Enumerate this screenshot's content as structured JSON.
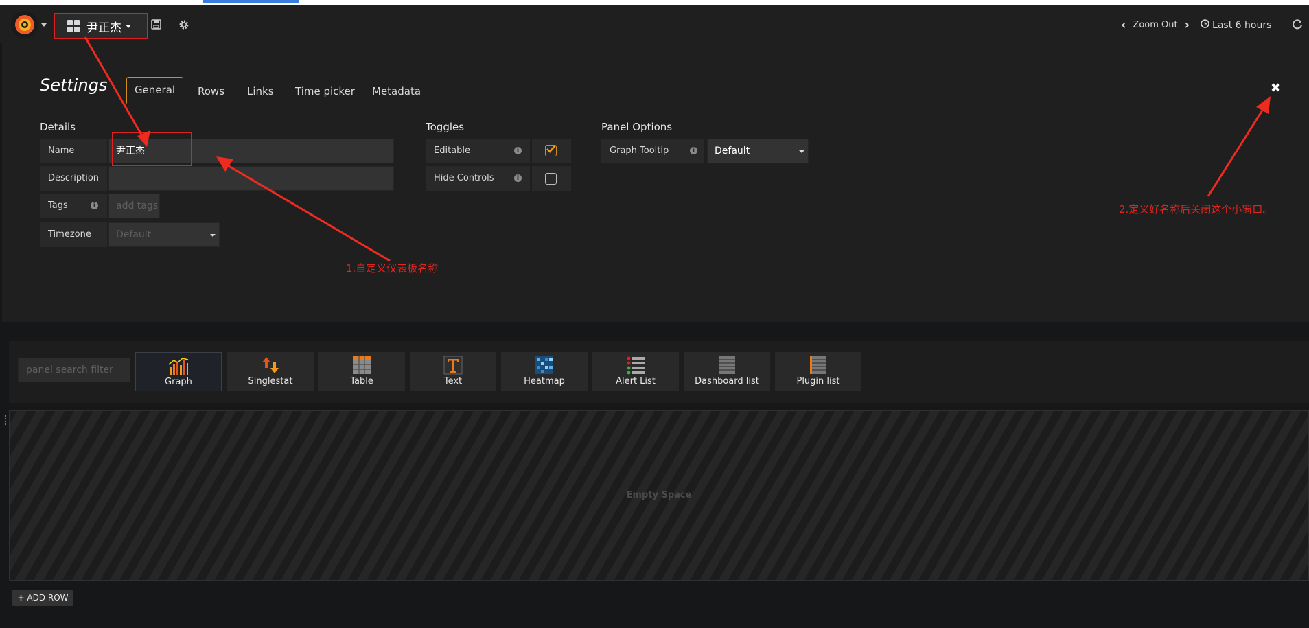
{
  "navbar": {
    "dashboard_title": "尹正杰",
    "zoom_out": "Zoom Out",
    "time_range": "Last 6 hours",
    "icons": [
      "grafana-logo-icon",
      "save-icon",
      "gear-icon",
      "chevron-left-icon",
      "chevron-right-icon",
      "clock-icon",
      "refresh-icon"
    ]
  },
  "settings": {
    "title": "Settings",
    "tabs": [
      "General",
      "Rows",
      "Links",
      "Time picker",
      "Metadata"
    ],
    "active_tab": "General",
    "details": {
      "heading": "Details",
      "name_label": "Name",
      "name_value": "尹正杰",
      "description_label": "Description",
      "description_value": "",
      "tags_label": "Tags",
      "tags_placeholder": "add tags",
      "timezone_label": "Timezone",
      "timezone_value": "Default"
    },
    "toggles": {
      "heading": "Toggles",
      "editable_label": "Editable",
      "editable_checked": true,
      "hide_controls_label": "Hide Controls",
      "hide_controls_checked": false
    },
    "panel_options": {
      "heading": "Panel Options",
      "graph_tooltip_label": "Graph Tooltip",
      "graph_tooltip_value": "Default"
    }
  },
  "annotations": {
    "note1": "1.自定义仪表板名称",
    "note2": "2.定义好名称后关闭这个小窗口。"
  },
  "panel_picker": {
    "search_placeholder": "panel search filter",
    "panels": [
      "Graph",
      "Singlestat",
      "Table",
      "Text",
      "Heatmap",
      "Alert List",
      "Dashboard list",
      "Plugin list"
    ],
    "selected": "Graph"
  },
  "row": {
    "empty_space": "Empty Space",
    "add_row": "ADD ROW"
  },
  "colors": {
    "accent_orange": "#d18a1b",
    "annotation_red": "#e0261f",
    "background": "#161719"
  }
}
